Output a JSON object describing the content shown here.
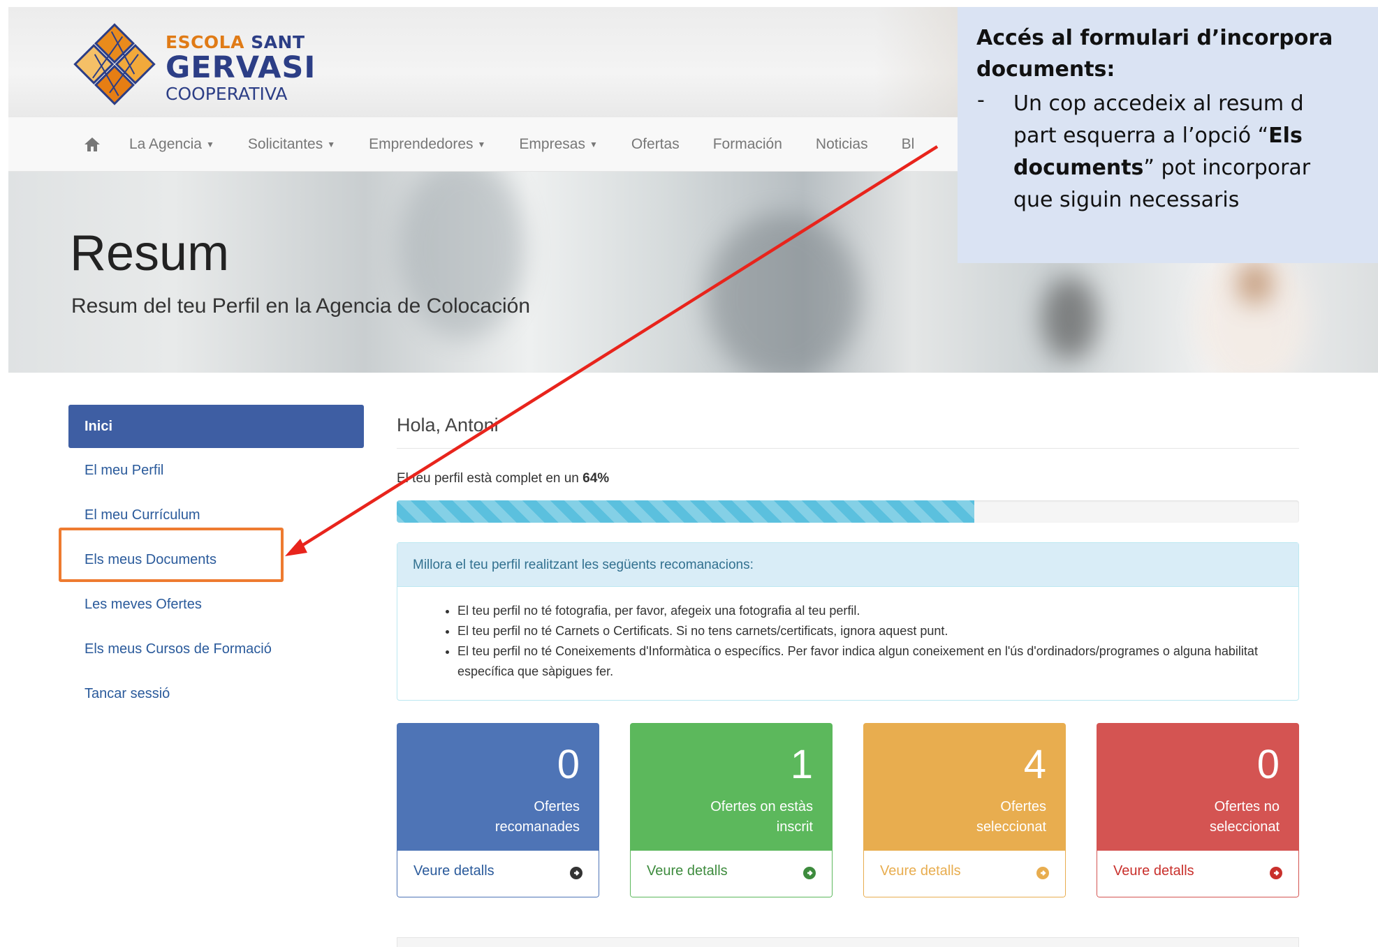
{
  "header": {
    "logo": {
      "line1_orange": "ESCOLA",
      "line1_navy": "SANT",
      "line2": "GERVASI",
      "line3": "COOPERATIVA"
    }
  },
  "nav": {
    "items": [
      {
        "label": "La Agencia",
        "dropdown": true
      },
      {
        "label": "Solicitantes",
        "dropdown": true
      },
      {
        "label": "Emprendedores",
        "dropdown": true
      },
      {
        "label": "Empresas",
        "dropdown": true
      },
      {
        "label": "Ofertas",
        "dropdown": false
      },
      {
        "label": "Formación",
        "dropdown": false
      },
      {
        "label": "Noticias",
        "dropdown": false
      },
      {
        "label": "Bl",
        "dropdown": false
      }
    ]
  },
  "banner": {
    "title": "Resum",
    "subtitle": "Resum del teu Perfil en la Agencia de Colocación"
  },
  "sidebar": {
    "items": [
      {
        "label": "Inici"
      },
      {
        "label": "El meu Perfil"
      },
      {
        "label": "El meu Currículum"
      },
      {
        "label": "Els meus Documents"
      },
      {
        "label": "Les meves Ofertes"
      },
      {
        "label": "Els meus Cursos de Formació"
      },
      {
        "label": "Tancar sessió"
      }
    ]
  },
  "main": {
    "greeting": "Hola, Antoni",
    "profile_text_prefix": "El teu perfil està complet en un ",
    "profile_percent_label": "64%",
    "profile_progress": 0.64,
    "recommendations": {
      "heading": "Millora el teu perfil realitzant les següents recomanacions:",
      "items": [
        "El teu perfil no té fotografia, per favor, afegeix una fotografia al teu perfil.",
        "El teu perfil no té Carnets o Certificats. Si no tens carnets/certificats, ignora aquest punt.",
        "El teu perfil no té Coneixements d'Informàtica o específics. Per favor indica algun coneixement en l'ús d'ordinadors/programes o alguna habilitat específica que sàpigues fer."
      ]
    },
    "stats": [
      {
        "count": "0",
        "label_1": "Ofertes",
        "label_2": "recomanades",
        "link": "Veure detalls",
        "color": "#4e74b6",
        "link_color": "#2a5a9b"
      },
      {
        "count": "1",
        "label_1": "Ofertes on estàs",
        "label_2": "inscrit",
        "link": "Veure detalls",
        "color": "#5cb85c",
        "link_color": "#3d8b3d"
      },
      {
        "count": "4",
        "label_1": "Ofertes",
        "label_2": "seleccionat",
        "link": "Veure detalls",
        "color": "#e8ad4f",
        "link_color": "#e8ad4f"
      },
      {
        "count": "0",
        "label_1": "Ofertes no",
        "label_2": "seleccionat",
        "link": "Veure detalls",
        "color": "#d45452",
        "link_color": "#c9302c"
      }
    ]
  },
  "callout": {
    "title_1": "Accés al formulari d’incorpora",
    "title_2": "documents:",
    "dash": "-",
    "body_1": "Un cop accedeix al resum d",
    "body_2_pre": "part esquerra a l’opció “",
    "body_2_bold": "Els",
    "body_3_bold": "documents",
    "body_3_post": "” pot incorporar",
    "body_4": "que siguin necessaris"
  },
  "colors": {
    "highlight_box": "#ee7b30",
    "arrow": "#e8241c",
    "sidebar_active": "#3e5ea3",
    "callout_bg": "#dae3f3"
  }
}
